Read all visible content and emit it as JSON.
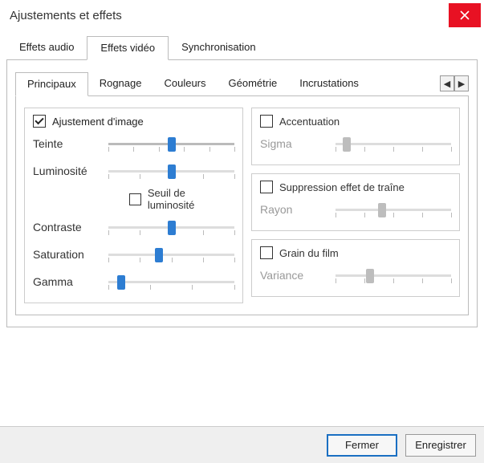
{
  "window": {
    "title": "Ajustements et effets"
  },
  "outer_tabs": {
    "audio": "Effets audio",
    "video": "Effets vidéo",
    "sync": "Synchronisation",
    "active": 1
  },
  "inner_tabs": {
    "items": [
      "Principaux",
      "Rognage",
      "Couleurs",
      "Géométrie",
      "Incrustations"
    ],
    "active": 0
  },
  "left_group": {
    "title": "Ajustement d'image",
    "checked": true,
    "sliders": {
      "hue": {
        "label": "Teinte",
        "value": 0.5
      },
      "brightness": {
        "label": "Luminosité",
        "value": 0.5
      },
      "contrast": {
        "label": "Contraste",
        "value": 0.5
      },
      "saturation": {
        "label": "Saturation",
        "value": 0.4
      },
      "gamma": {
        "label": "Gamma",
        "value": 0.1
      }
    },
    "brightness_threshold": {
      "label": "Seuil de luminosité",
      "checked": false
    }
  },
  "right_groups": {
    "sharpen": {
      "title": "Accentuation",
      "checked": false,
      "slider": {
        "label": "Sigma",
        "value": 0.1
      }
    },
    "banding": {
      "title": "Suppression effet de traîne",
      "checked": false,
      "slider": {
        "label": "Rayon",
        "value": 0.4
      }
    },
    "grain": {
      "title": "Grain du film",
      "checked": false,
      "slider": {
        "label": "Variance",
        "value": 0.3
      }
    }
  },
  "footer": {
    "close": "Fermer",
    "save": "Enregistrer"
  }
}
